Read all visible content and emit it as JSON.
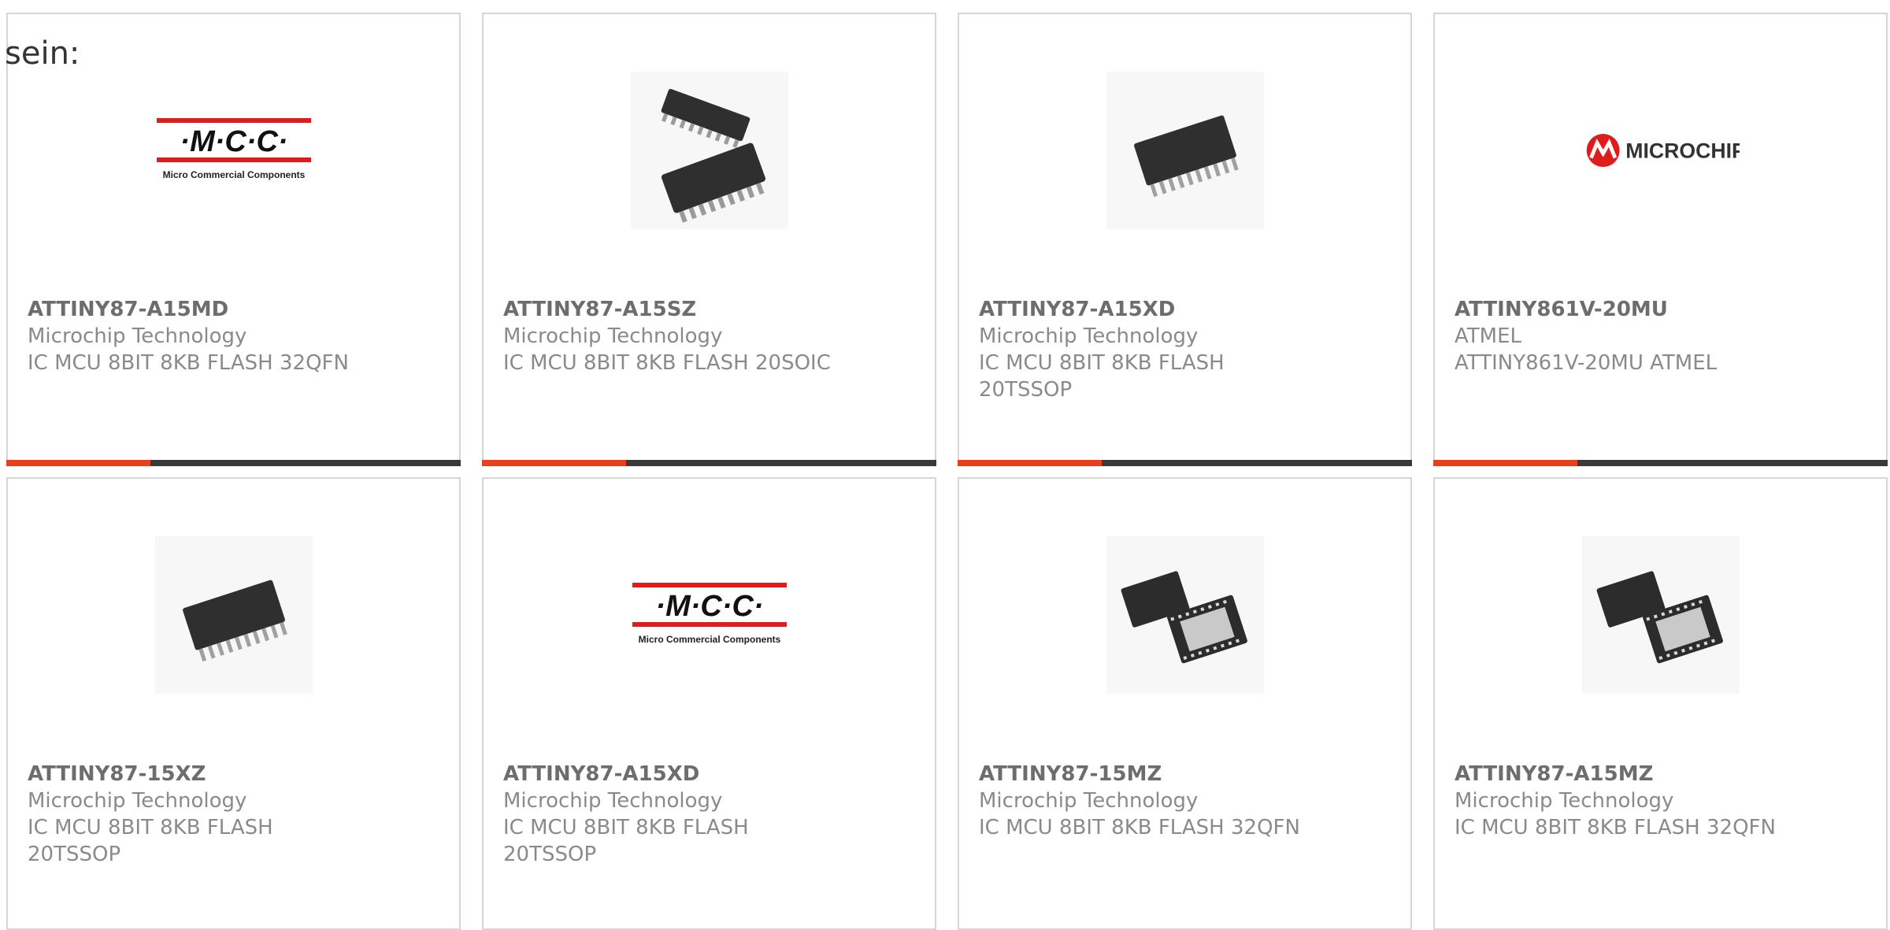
{
  "intro_text": "sein:",
  "accent_color": "#e8401c",
  "bar_color": "#3a3a3a",
  "products": [
    {
      "part": "ATTINY87-A15MD",
      "maker": "Microchip Technology",
      "desc": "IC MCU 8BIT 8KB FLASH 32QFN",
      "image": "mcc-logo"
    },
    {
      "part": "ATTINY87-A15SZ",
      "maker": "Microchip Technology",
      "desc": "IC MCU 8BIT 8KB FLASH 20SOIC",
      "image": "soic-chip-icon"
    },
    {
      "part": "ATTINY87-A15XD",
      "maker": "Microchip Technology",
      "desc": "IC MCU 8BIT 8KB FLASH 20TSSOP",
      "image": "tssop-chip-icon"
    },
    {
      "part": "ATTINY861V-20MU",
      "maker": "ATMEL",
      "desc": "ATTINY861V-20MU ATMEL",
      "image": "microchip-logo"
    },
    {
      "part": "ATTINY87-15XZ",
      "maker": "Microchip Technology",
      "desc": "IC MCU 8BIT 8KB FLASH 20TSSOP",
      "image": "tssop-chip-icon"
    },
    {
      "part": "ATTINY87-A15XD",
      "maker": "Microchip Technology",
      "desc": "IC MCU 8BIT 8KB FLASH 20TSSOP",
      "image": "mcc-logo"
    },
    {
      "part": "ATTINY87-15MZ",
      "maker": "Microchip Technology",
      "desc": "IC MCU 8BIT 8KB FLASH 32QFN",
      "image": "qfn-chip-icon"
    },
    {
      "part": "ATTINY87-A15MZ",
      "maker": "Microchip Technology",
      "desc": "IC MCU 8BIT 8KB FLASH 32QFN",
      "image": "qfn-chip-icon"
    }
  ],
  "logos": {
    "mcc_text": "·M·C·C·",
    "mcc_sub": "Micro Commercial Components",
    "microchip_text": "MICROCHIP"
  }
}
